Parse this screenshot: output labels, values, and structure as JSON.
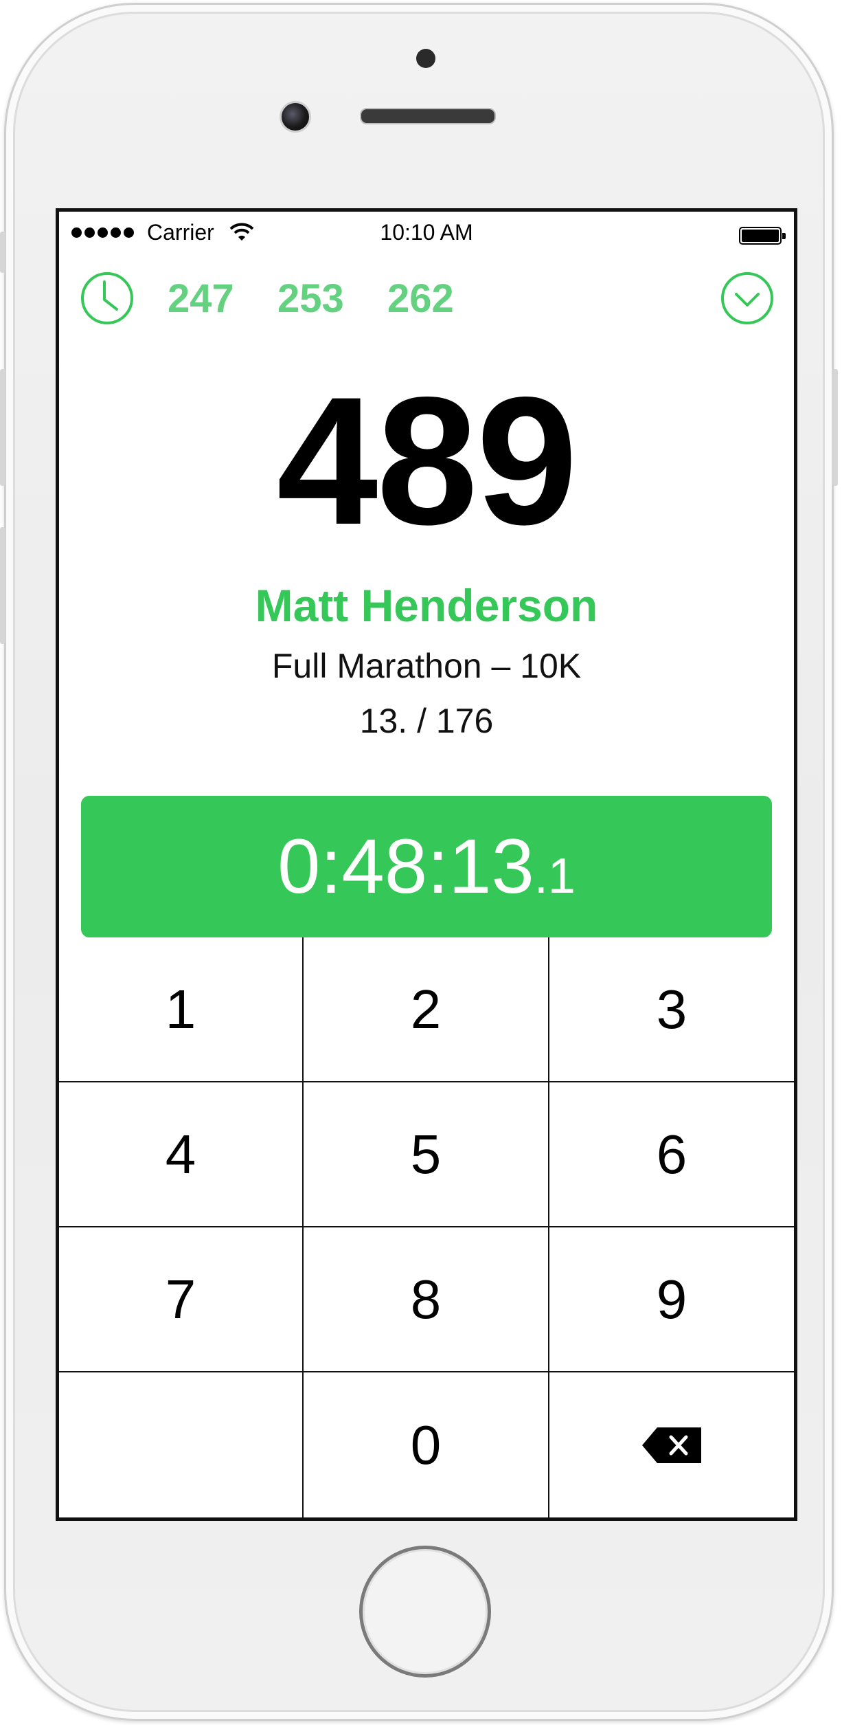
{
  "status_bar": {
    "carrier": "Carrier",
    "time": "10:10 AM"
  },
  "toolbar": {
    "history_icon": "clock-icon",
    "recent_bibs": [
      "247",
      "253",
      "262"
    ],
    "collapse_icon": "chevron-down-circle-icon"
  },
  "runner": {
    "bib": "489",
    "name": "Matt Henderson",
    "race": "Full Marathon – 10K",
    "rank": "13. / 176"
  },
  "timer": {
    "main": "0:48:13",
    "tenths": ".1"
  },
  "keypad": {
    "keys": [
      "1",
      "2",
      "3",
      "4",
      "5",
      "6",
      "7",
      "8",
      "9",
      "",
      "0"
    ],
    "delete_icon": "backspace-icon"
  },
  "colors": {
    "accent": "#36c759",
    "recent_bibs": "#63d17f"
  }
}
